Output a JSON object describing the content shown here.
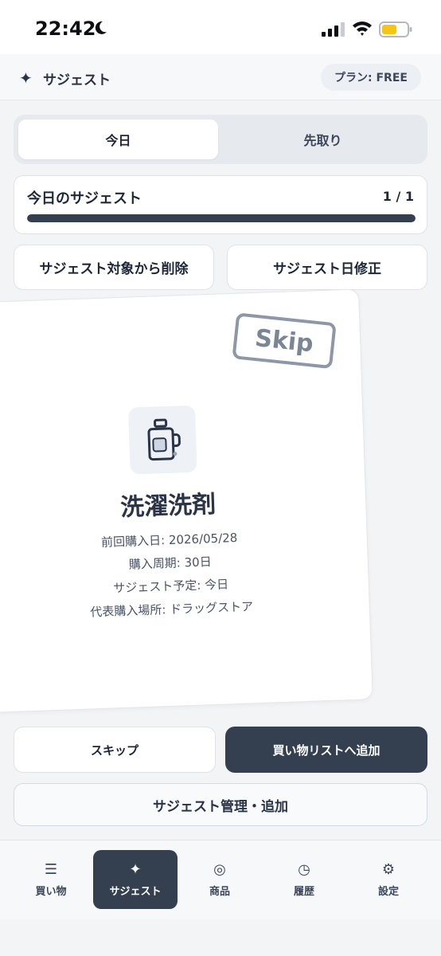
{
  "status_bar": {
    "time": "22:42"
  },
  "header": {
    "icon": "✦",
    "title": "サジェスト",
    "plan": "プラン: FREE"
  },
  "segments": {
    "today": "今日",
    "ahead": "先取り",
    "active": "today"
  },
  "progress": {
    "title": "今日のサジェスト",
    "count": "1 / 1",
    "fraction": 1.0
  },
  "actions": {
    "remove": "サジェスト対象から削除",
    "fix_date": "サジェスト日修正"
  },
  "card": {
    "stamp": "Skip",
    "icon_name": "detergent-bottle-icon",
    "product_name": "洗濯洗剤",
    "details": {
      "last_purchase": "前回購入日: 2026/05/28",
      "cycle": "購入周期: 30日",
      "scheduled": "サジェスト予定: 今日",
      "store": "代表購入場所: ドラッグストア"
    }
  },
  "buttons": {
    "skip": "スキップ",
    "add_to_list": "買い物リストへ追加",
    "manage": "サジェスト管理・追加"
  },
  "tabbar": {
    "items": [
      {
        "label": "買い物",
        "icon": "☰",
        "icon_name": "list-icon"
      },
      {
        "label": "サジェスト",
        "icon": "✦",
        "icon_name": "sparkle-icon"
      },
      {
        "label": "商品",
        "icon": "◎",
        "icon_name": "product-icon"
      },
      {
        "label": "履歴",
        "icon": "◷",
        "icon_name": "clock-icon"
      },
      {
        "label": "設定",
        "icon": "⚙",
        "icon_name": "gear-icon"
      }
    ],
    "active_index": 1
  },
  "colors": {
    "primary": "#34404f",
    "background": "#f3f4f6",
    "battery": "#f5c518"
  }
}
